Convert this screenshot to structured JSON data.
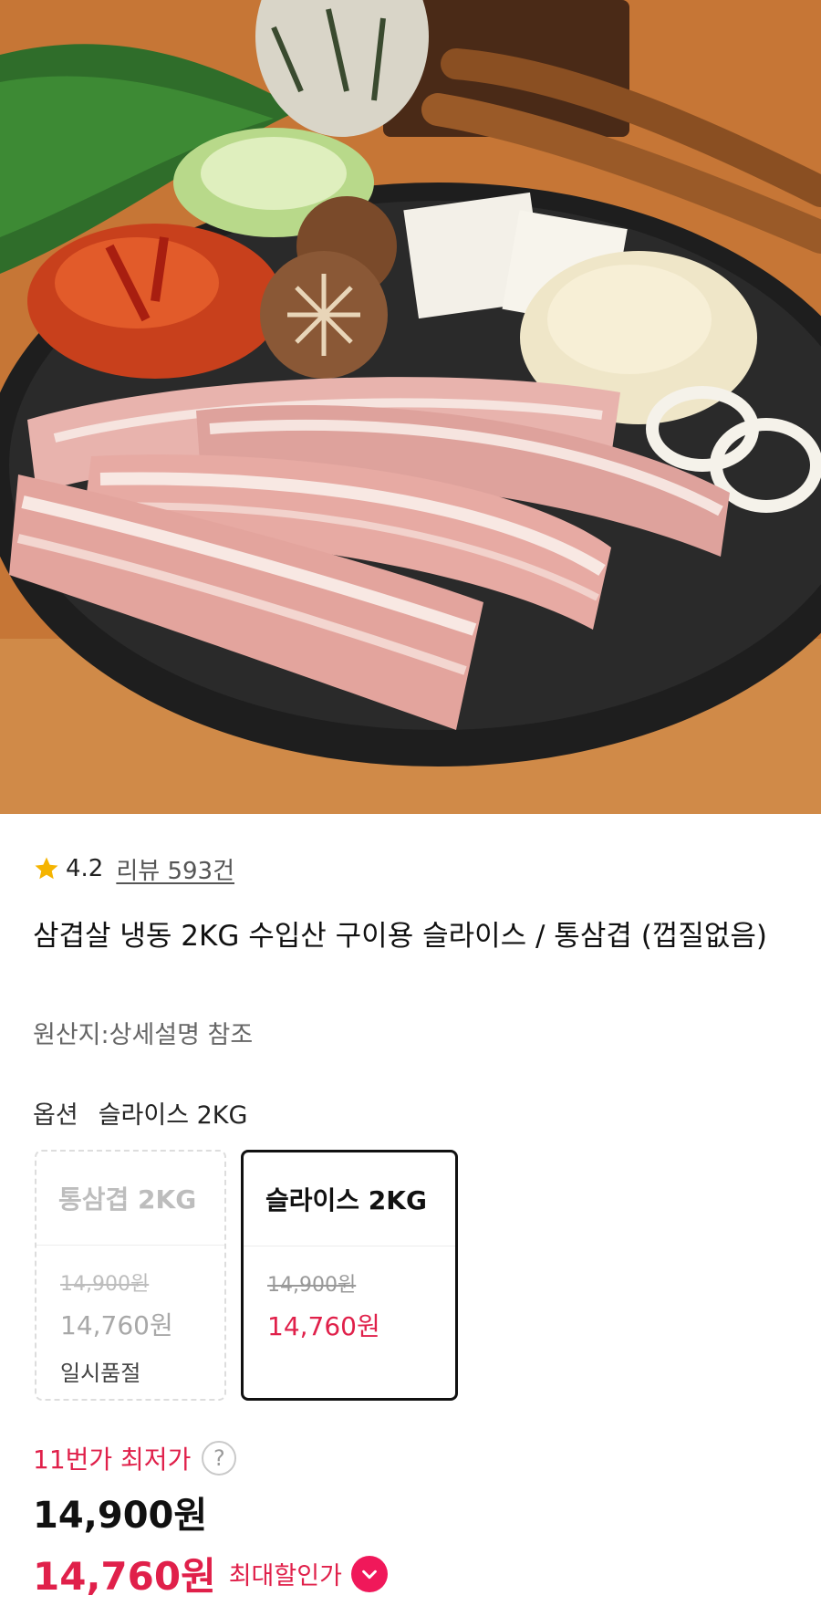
{
  "product": {
    "image_alt": "product-photo",
    "rating": "4.2",
    "review_link": "리뷰 593건",
    "title": "삼겹살 냉동 2KG 수입산 구이용 슬라이스 / 통삼겹 (껍질없음)",
    "origin": "원산지:상세설명 참조"
  },
  "option": {
    "label": "옵션",
    "selected_value": "슬라이스 2KG",
    "cards": [
      {
        "name": "통삼겹 2KG",
        "original_price": "14,900원",
        "sale_price": "14,760원",
        "status": "일시품절"
      },
      {
        "name": "슬라이스 2KG",
        "original_price": "14,900원",
        "sale_price": "14,760원"
      }
    ]
  },
  "pricing": {
    "lowest_label": "11번가 최저가",
    "help_glyph": "?",
    "regular_price": "14,900원",
    "final_price": "14,760원",
    "max_discount_label": "최대할인가"
  },
  "colors": {
    "accent": "#e0204a",
    "badge": "#f0185a",
    "star": "#f5b400"
  }
}
